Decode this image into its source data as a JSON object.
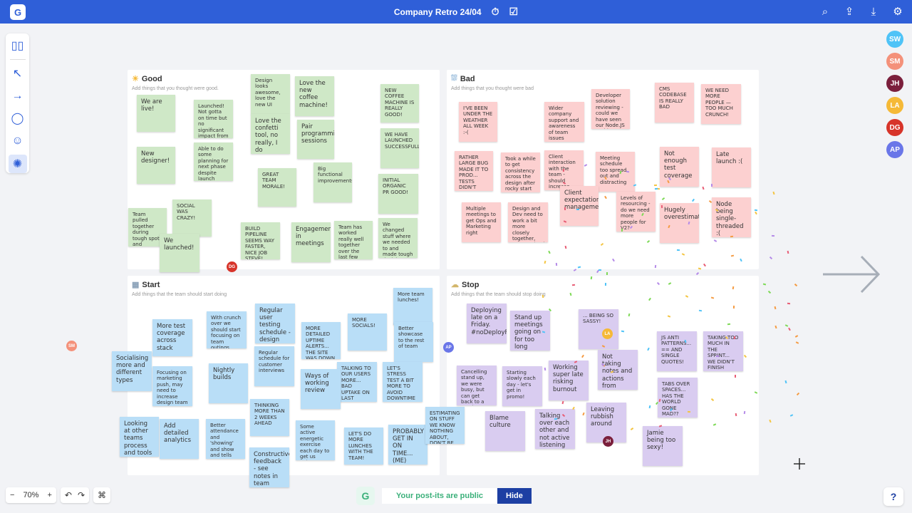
{
  "header": {
    "logo": "G",
    "title": "Company Retro 24/04",
    "timer_icon": "timer-icon",
    "checklist_icon": "checklist-icon",
    "actions": [
      {
        "name": "search-people-icon",
        "glyph": "⌕"
      },
      {
        "name": "share-icon",
        "glyph": "⇪"
      },
      {
        "name": "download-icon",
        "glyph": "⤓"
      },
      {
        "name": "settings-icon",
        "glyph": "⚙"
      }
    ]
  },
  "toolbar": [
    {
      "name": "panels-tool",
      "glyph": "▯▯"
    },
    {
      "name": "select-tool",
      "glyph": "↖"
    },
    {
      "name": "arrow-tool",
      "glyph": "→"
    },
    {
      "name": "comment-tool",
      "glyph": "◯"
    },
    {
      "name": "emoji-tool",
      "glyph": "☺"
    },
    {
      "name": "celebrate-tool",
      "glyph": "✺"
    }
  ],
  "avatars": [
    {
      "initials": "SW",
      "color": "#4fc3f7"
    },
    {
      "initials": "SM",
      "color": "#f4917a"
    },
    {
      "initials": "JH",
      "color": "#7b1f3c"
    },
    {
      "initials": "LA",
      "color": "#f5b937"
    },
    {
      "initials": "DG",
      "color": "#d7342a"
    },
    {
      "initials": "AP",
      "color": "#6a76e8"
    }
  ],
  "panels": [
    {
      "key": "good",
      "title": "Good",
      "subtitle": "Add things that you thought were good.",
      "icon": "☀"
    },
    {
      "key": "bad",
      "title": "Bad",
      "subtitle": "Add things that you thought were bad",
      "icon": "⛆"
    },
    {
      "key": "start",
      "title": "Start",
      "subtitle": "Add things that the team should start doing",
      "icon": "▦"
    },
    {
      "key": "stop",
      "title": "Stop",
      "subtitle": "Add things that the team should stop doing",
      "icon": "☁"
    }
  ],
  "notes": {
    "good": [
      "We are live!",
      "Launched! Not gotta on time but no significant impact from delay",
      "Design looks awesome, love the new UI",
      "Love the new coffee machine!",
      "NEW COFFEE MACHINE IS REALLY GOOD!",
      "New designer!",
      "Able to do some planning for next phase despite launch pressure",
      "Love the confetti tool, no really, I do",
      "Pair programming sessions",
      "WE HAVE LAUNCHED SUCCESSFULLY!",
      "GREAT TEAM MORALE!",
      "Big functional improvements",
      "INITIAL ORGANIC PR GOOD!",
      "SOCIAL WAS CRAZY!",
      "Team pulled together during tough spots and performed well",
      "We launched!",
      "BUILD PIPELINE SEEMS WAY FASTER, NICE JOB STEVE!",
      "Engagement in meetings",
      "Team has worked really well together over the last few months of crunch",
      "We changed stuff where we needed to and made tough decisions"
    ],
    "bad": [
      "I'VE BEEN UNDER THE WEATHER ALL WEEK :-(",
      "Wider company support and awareness of team issues",
      "Developer solution reviewing - could we have seen our Node.JS problem coming?",
      "CMS CODEBASE IS REALLY BAD",
      "WE NEED MORE PEOPLE — TOO MUCH CRUNCH!",
      "RATHER LARGE BUG MADE IT TO PROD... TESTS DIDN'T CATCH THEM?",
      "Took a while to get consistency across the design after rocky start",
      "Client interaction with the team - should increase",
      "Meeting schedule too spread out and distracting",
      "Not enough test coverage",
      "Late launch :(",
      "Client expectation management",
      "Multiple meetings to get Ops and Marketing right",
      "Design and Dev need to work a bit more closely together, communication can improve.",
      "Levels of resourcing - do we need more people for V2?",
      "Hugely overestimating",
      "Node being single-threaded :("
    ],
    "start": [
      "More test coverage across stack",
      "With crunch over we should start focusing on team outings. People need a break",
      "Regular user testing schedule - design own",
      "MORE DETAILED UPTIME ALERTS... THE SITE WAS DOWN FOR 10 WHOLE MINUTES!",
      "MORE SOCIALS!",
      "More team lunches!",
      "Socialising more and different types",
      "Focusing on marketing push, may need to increase design team",
      "Nightly builds",
      "Regular schedule for customer interviews",
      "TALKING TO OUR USERS MORE... BAD UPTAKE ON LAST WEEK'S FEATURE",
      "Better showcase to the rest of team",
      "Ways of working review",
      "LET'S STRESS TEST A BIT MORE TO AVOID DOWNTIME",
      "Looking at other teams process and tools - can we reuse?",
      "Add detailed analytics",
      "Better attendance and 'showing' and show and tells",
      "THINKING MORE THAN 2 WEEKS AHEAD",
      "Some active energetic exercise each day to get us going!",
      "LET'S DO MORE LUNCHES WITH THE TEAM!",
      "PROBABLY GET IN ON TIME... (ME)",
      "ESTIMATING ON STUFF WE KNOW NOTHING ABOUT, DON'T BE AFRAID TO USE INFINITY",
      "Constructive feedback - see notes in team space"
    ],
    "stop": [
      "Deploying late on a Friday. #noDeployFridays",
      "Stand up meetings going on for too long",
      "... BEING SO SASSY!",
      "JS ANTI PATTERNS... == AND SINGLE QUOTES!",
      "TAKING TOO MUCH IN THE SPRINT... WE DIDN'T FINISH AGAIN",
      "Cancelling stand up, we were busy, but can get back to a good routine now",
      "Starting slowly each day - let's get in promo!",
      "Working super late risking burnout",
      "Not taking notes and actions from retros",
      "TABS OVER SPACES... HAS THE WORLD GONE MAD??",
      "Blame culture",
      "Talking over each other and not active listening",
      "Leaving rubbish around",
      "Jamie being too sexy!"
    ]
  },
  "markers": [
    {
      "initials": "DG",
      "color": "#d7342a"
    },
    {
      "initials": "SM",
      "color": "#f4917a"
    },
    {
      "initials": "AP",
      "color": "#6a76e8"
    },
    {
      "initials": "LA",
      "color": "#f5b937"
    },
    {
      "initials": "JH",
      "color": "#7b1f3c"
    }
  ],
  "zoom": {
    "minus": "−",
    "value": "70%",
    "plus": "+",
    "undo": "↶",
    "redo": "↷",
    "fit": "⌘"
  },
  "public": {
    "logo": "G",
    "text": "Your post-its are public",
    "hide": "Hide"
  },
  "help": "?"
}
